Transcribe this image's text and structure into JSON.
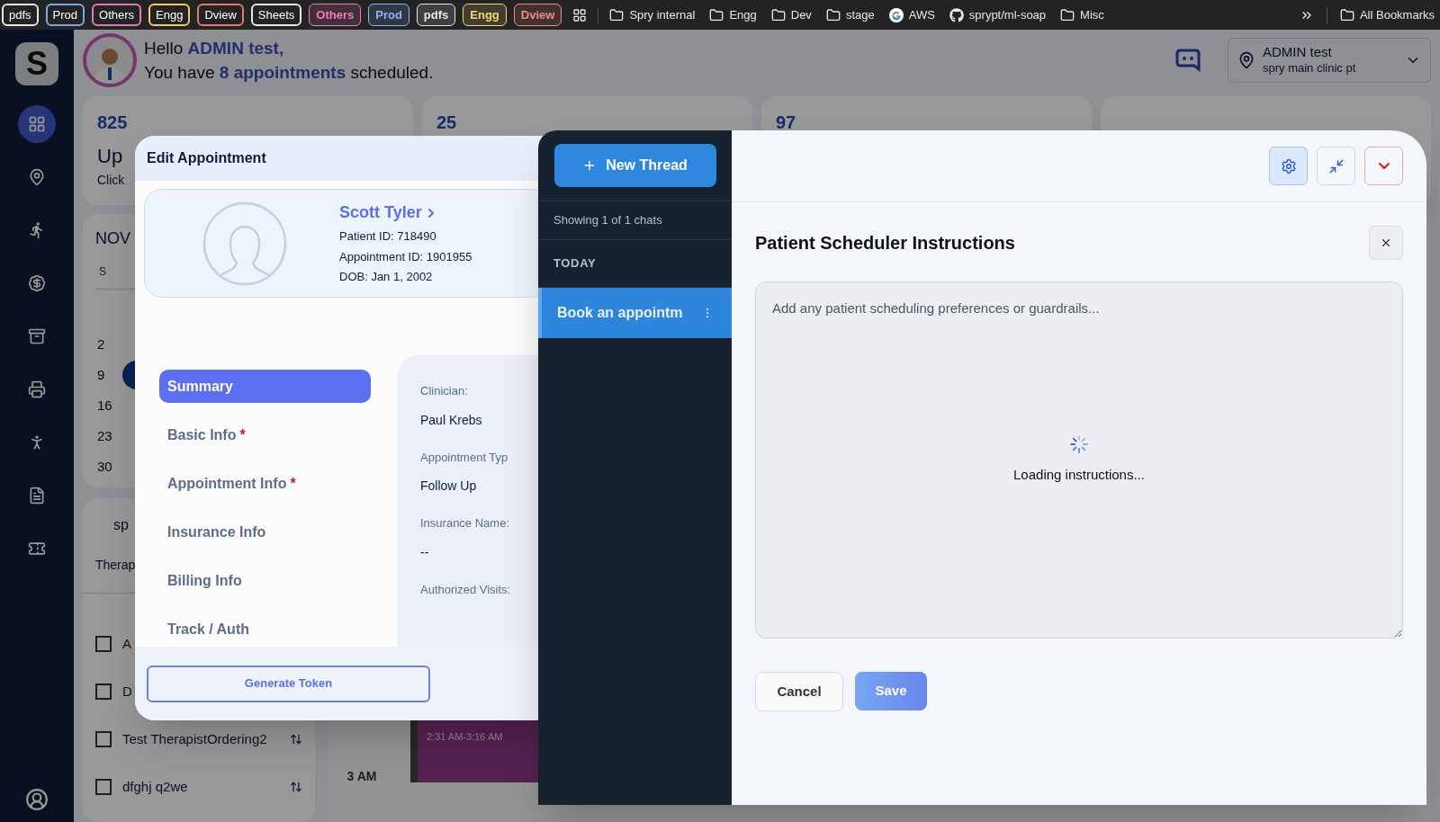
{
  "bookmarks_bar": {
    "chips": [
      {
        "label": "pdfs",
        "kind": "outlined",
        "color": "#e5e7eb"
      },
      {
        "label": "Prod",
        "kind": "outlined",
        "color": "#7aa7f5"
      },
      {
        "label": "Others",
        "kind": "outlined",
        "color": "#e879b9"
      },
      {
        "label": "Engg",
        "kind": "outlined",
        "color": "#f2cc5c"
      },
      {
        "label": "Dview",
        "kind": "outlined",
        "color": "#e07a6a"
      },
      {
        "label": "Sheets",
        "kind": "outlined",
        "color": "#e5e7eb"
      },
      {
        "label": "Others",
        "kind": "filled",
        "color": "#f07bbf"
      },
      {
        "label": "Prod",
        "kind": "filled",
        "color": "#8ab4f8"
      },
      {
        "label": "pdfs",
        "kind": "filled",
        "color": "#e5e7eb"
      },
      {
        "label": "Engg",
        "kind": "filled",
        "color": "#f5d77a"
      },
      {
        "label": "Dview",
        "kind": "filled",
        "color": "#f28b82"
      }
    ],
    "bookmarks": [
      {
        "label": "Spry internal",
        "kind": "folder"
      },
      {
        "label": "Engg",
        "kind": "folder"
      },
      {
        "label": "Dev",
        "kind": "folder"
      },
      {
        "label": "stage",
        "kind": "folder"
      },
      {
        "label": "AWS",
        "kind": "google"
      },
      {
        "label": "sprypt/ml-soap",
        "kind": "github"
      },
      {
        "label": "Misc",
        "kind": "folder"
      }
    ],
    "all_bookmarks": "All Bookmarks"
  },
  "sidebar": {
    "logo": "S",
    "items": [
      {
        "kind": "grid",
        "selected": true
      },
      {
        "kind": "pin",
        "selected": false
      },
      {
        "kind": "run",
        "selected": false
      },
      {
        "kind": "dollar",
        "selected": false
      },
      {
        "kind": "archive",
        "selected": false
      },
      {
        "kind": "printer",
        "selected": false
      },
      {
        "kind": "person",
        "selected": false
      },
      {
        "kind": "document",
        "selected": false
      },
      {
        "kind": "ticket",
        "selected": false
      }
    ]
  },
  "header": {
    "greeting": {
      "text": "Hello",
      "name": "ADMIN test,"
    },
    "summary": {
      "before": "You have",
      "count": "8 appointments",
      "after": "scheduled."
    },
    "account": {
      "name": "ADMIN test",
      "clinic": "spry main clinic pt"
    }
  },
  "stat_cards": [
    {
      "value": "825",
      "title": "Up",
      "subtitle": "Click"
    },
    {
      "value": "25"
    },
    {
      "value": "97"
    }
  ],
  "calendar": {
    "month": "NOV",
    "weekday": "S",
    "days": [
      "2",
      "9",
      "16",
      "23",
      "30"
    ],
    "today_marker": true
  },
  "therapists": {
    "title": "sp",
    "filter": "Therap",
    "rows": [
      {
        "name": "A",
        "checked": false
      },
      {
        "name": "D",
        "checked": false
      },
      {
        "name": "Test TherapistOrdering2",
        "checked": false,
        "sortable": true
      },
      {
        "name": "dfghj q2we",
        "checked": false,
        "sortable": true
      }
    ]
  },
  "schedule": {
    "time_label": "3 AM",
    "events": [
      {
        "time": "2:31 AM-3:16 AM"
      }
    ]
  },
  "edit_appointment": {
    "title": "Edit Appointment",
    "patient": {
      "name": "Scott Tyler",
      "details": [
        "Patient ID: 718490",
        "Appointment ID: 1901955",
        "DOB: Jan 1, 2002"
      ]
    },
    "required_mark": "*",
    "sections": [
      {
        "label": "Summary",
        "selected": true,
        "required": false
      },
      {
        "label": "Basic Info",
        "selected": false,
        "required": true
      },
      {
        "label": "Appointment Info",
        "selected": false,
        "required": true
      },
      {
        "label": "Insurance Info",
        "selected": false,
        "required": false
      },
      {
        "label": "Billing Info",
        "selected": false,
        "required": false
      },
      {
        "label": "Track / Auth",
        "selected": false,
        "required": false
      }
    ],
    "fields": [
      {
        "label": "Clinician:",
        "value": "Paul Krebs"
      },
      {
        "label": "Appointment Typ",
        "value": "Follow Up"
      },
      {
        "label": "Insurance Name:",
        "value": "--"
      },
      {
        "label": "Authorized Visits:"
      }
    ],
    "footer_button": "Generate Token"
  },
  "chat": {
    "new_thread": "New Thread",
    "count": "Showing 1 of 1 chats",
    "groups": [
      {
        "label": "TODAY",
        "threads": [
          {
            "title": "Book an appointm",
            "selected": true
          }
        ]
      }
    ],
    "header_buttons": [
      {
        "kind": "settings",
        "selected": true
      },
      {
        "kind": "minimize",
        "selected": false
      },
      {
        "kind": "collapse",
        "selected": false
      }
    ],
    "instructions": {
      "title": "Patient Scheduler Instructions",
      "placeholder": "Add any patient scheduling preferences or guardrails...",
      "loading": "Loading instructions...",
      "cancel": "Cancel",
      "save": "Save"
    }
  }
}
